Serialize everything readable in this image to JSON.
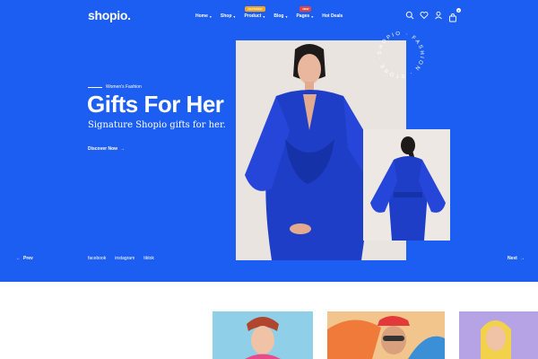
{
  "header": {
    "logo": "shopio.",
    "nav": [
      {
        "label": "Home",
        "badge": "",
        "badge_color": ""
      },
      {
        "label": "Shop",
        "badge": "",
        "badge_color": ""
      },
      {
        "label": "Product",
        "badge": "FEATURED",
        "badge_color": "#f5a623"
      },
      {
        "label": "Blog",
        "badge": "",
        "badge_color": ""
      },
      {
        "label": "Pages",
        "badge": "NEW",
        "badge_color": "#e8443a"
      },
      {
        "label": "Hot Deals",
        "badge": "",
        "badge_color": ""
      }
    ],
    "icons": [
      "search-icon",
      "heart-icon",
      "user-icon",
      "cart-icon"
    ],
    "cart_count": "0"
  },
  "hero": {
    "eyebrow": "Women's Fashion",
    "title": "Gifts For Her",
    "subtitle": "Signature Shopio gifts for her.",
    "cta": "Discover Now",
    "badge_text": "SHOPIO · FASHION · STORE · ",
    "background": "#1d5ef2"
  },
  "socials": [
    "facebook",
    "instagram",
    "tiktok"
  ],
  "slider": {
    "prev": "Prev",
    "next": "Next"
  }
}
